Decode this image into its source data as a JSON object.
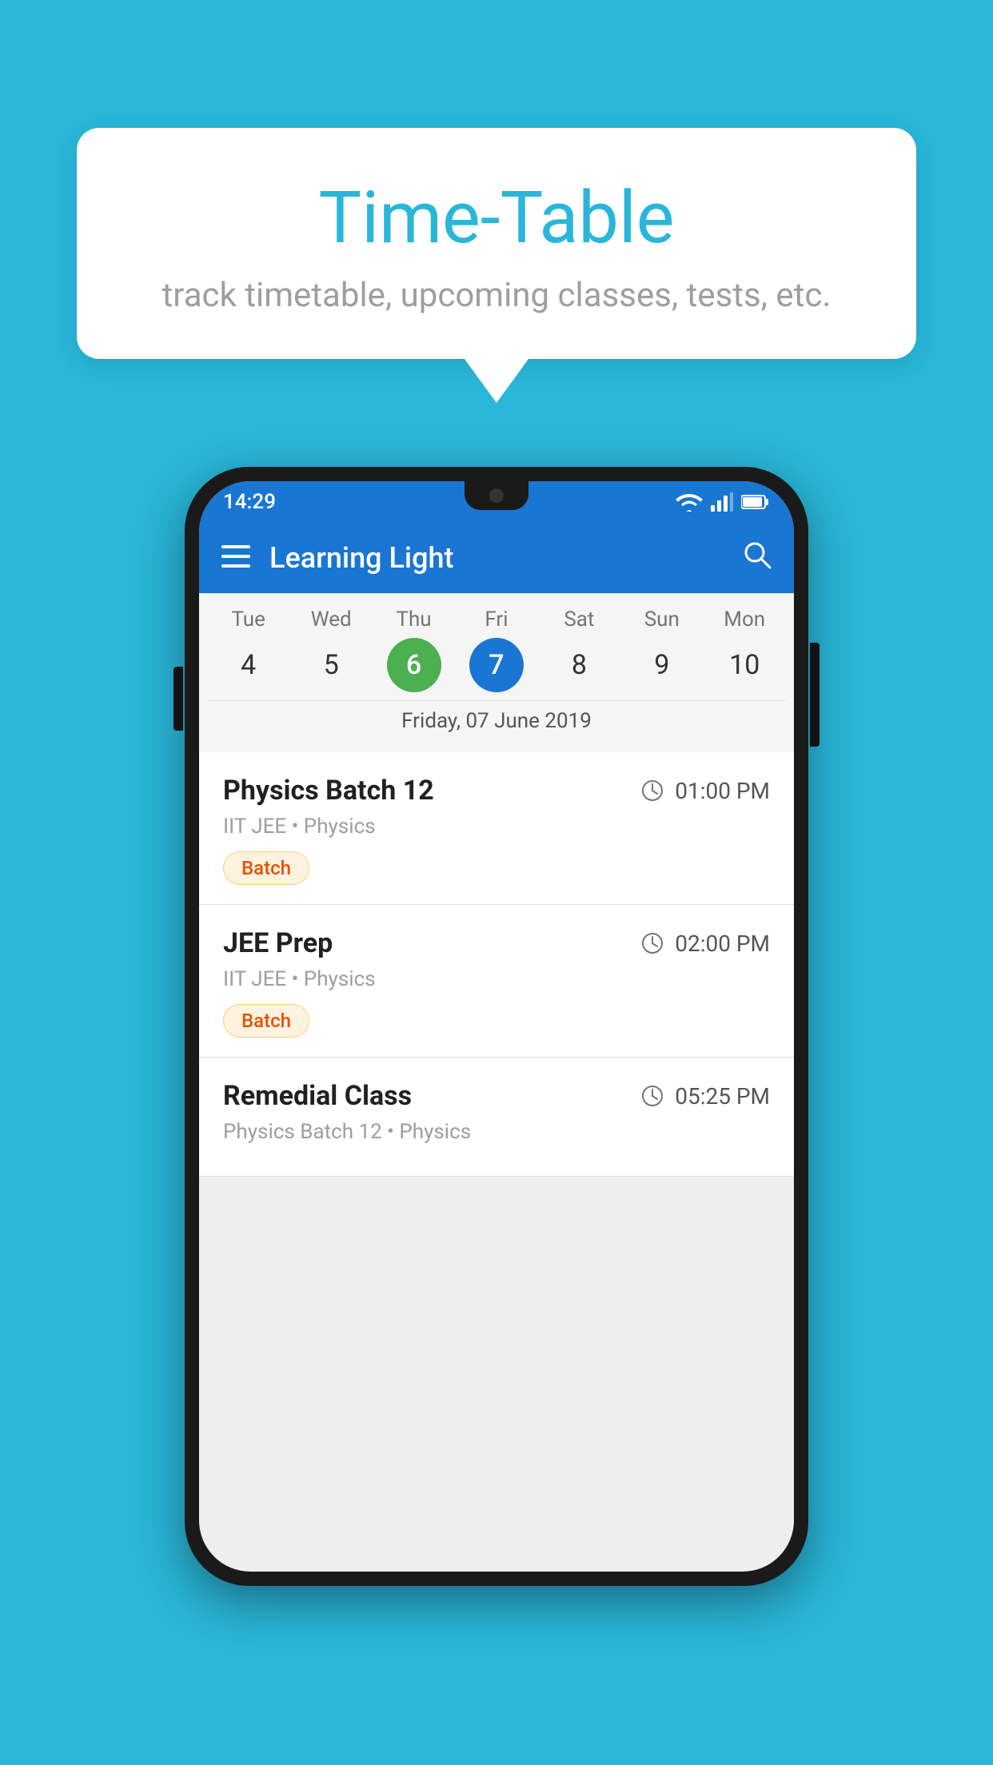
{
  "background_color": "#29B6D9",
  "speech_bubble": {
    "title": "Time-Table",
    "subtitle": "track timetable, upcoming classes, tests, etc."
  },
  "status_bar": {
    "time": "14:29",
    "color": "#1976D2"
  },
  "app_bar": {
    "title": "Learning Light",
    "color": "#1976D2"
  },
  "calendar": {
    "selected_date_label": "Friday, 07 June 2019",
    "days": [
      {
        "name": "Tue",
        "num": "4",
        "state": "normal"
      },
      {
        "name": "Wed",
        "num": "5",
        "state": "normal"
      },
      {
        "name": "Thu",
        "num": "6",
        "state": "today"
      },
      {
        "name": "Fri",
        "num": "7",
        "state": "selected"
      },
      {
        "name": "Sat",
        "num": "8",
        "state": "normal"
      },
      {
        "name": "Sun",
        "num": "9",
        "state": "normal"
      },
      {
        "name": "Mon",
        "num": "10",
        "state": "normal"
      }
    ]
  },
  "classes": [
    {
      "name": "Physics Batch 12",
      "time": "01:00 PM",
      "meta": "IIT JEE • Physics",
      "badge": "Batch"
    },
    {
      "name": "JEE Prep",
      "time": "02:00 PM",
      "meta": "IIT JEE • Physics",
      "badge": "Batch"
    },
    {
      "name": "Remedial Class",
      "time": "05:25 PM",
      "meta": "Physics Batch 12 • Physics",
      "badge": null
    }
  ],
  "icons": {
    "hamburger": "≡",
    "search": "🔍",
    "clock": "🕐"
  }
}
